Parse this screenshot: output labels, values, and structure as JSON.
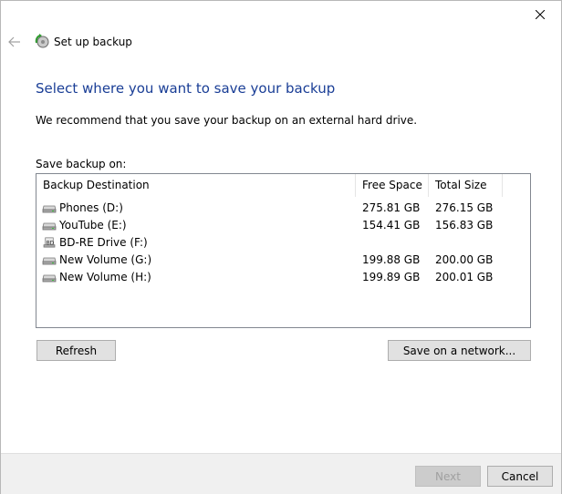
{
  "window": {
    "title": "Set up backup"
  },
  "heading": "Select where you want to save your backup",
  "recommendation": "We recommend that you save your backup on an external hard drive.",
  "save_on_label": "Save backup on:",
  "table": {
    "columns": [
      "Backup Destination",
      "Free Space",
      "Total Size"
    ],
    "rows": [
      {
        "name": "Phones (D:)",
        "free": "275.81 GB",
        "total": "276.15 GB",
        "icon": "hard-drive-icon"
      },
      {
        "name": "YouTube (E:)",
        "free": "154.41 GB",
        "total": "156.83 GB",
        "icon": "hard-drive-icon"
      },
      {
        "name": "BD-RE Drive (F:)",
        "free": "",
        "total": "",
        "icon": "optical-drive-icon"
      },
      {
        "name": "New Volume (G:)",
        "free": "199.88 GB",
        "total": "200.00 GB",
        "icon": "hard-drive-icon"
      },
      {
        "name": "New Volume (H:)",
        "free": "199.89 GB",
        "total": "200.01 GB",
        "icon": "hard-drive-icon"
      }
    ]
  },
  "buttons": {
    "refresh": "Refresh",
    "network": "Save on a network...",
    "next": "Next",
    "cancel": "Cancel"
  },
  "colors": {
    "heading": "#1a3e96",
    "button_face": "#e1e1e1",
    "footer": "#f0f0f0"
  }
}
